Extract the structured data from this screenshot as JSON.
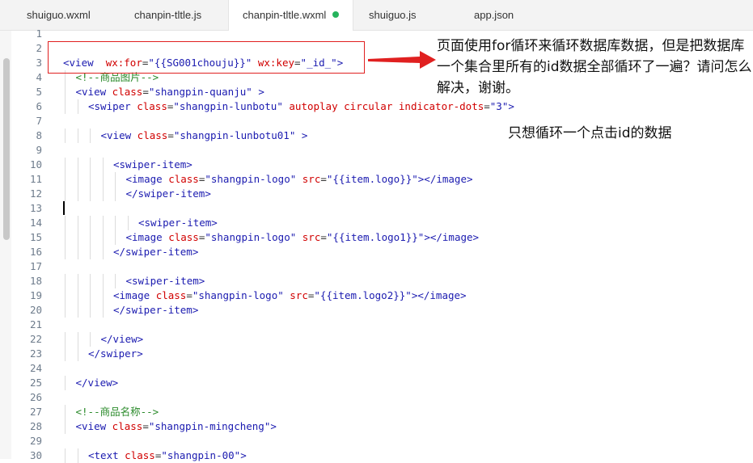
{
  "tabs": [
    {
      "label": "shuiguo.wxml"
    },
    {
      "label": "chanpin-tltle.js"
    },
    {
      "label": "chanpin-tltle.wxml",
      "active": true,
      "modified": true
    },
    {
      "label": "shuiguo.js"
    },
    {
      "label": "app.json"
    }
  ],
  "editor": {
    "lines": [
      {
        "n": "1",
        "indent": 0,
        "tokens": []
      },
      {
        "n": "2",
        "indent": 0,
        "tokens": []
      },
      {
        "n": "3",
        "indent": 0,
        "tokens": [
          {
            "c": "t-tag",
            "t": "<view"
          },
          {
            "c": "t-p",
            "t": "  "
          },
          {
            "c": "t-attr",
            "t": "wx:for"
          },
          {
            "c": "t-p",
            "t": "="
          },
          {
            "c": "t-str",
            "t": "\"{{SG001chouju}}\""
          },
          {
            "c": "t-p",
            "t": " "
          },
          {
            "c": "t-attr",
            "t": "wx:key"
          },
          {
            "c": "t-p",
            "t": "="
          },
          {
            "c": "t-str",
            "t": "\"_id_\""
          },
          {
            "c": "t-tag",
            "t": ">"
          }
        ]
      },
      {
        "n": "4",
        "indent": 1,
        "tokens": [
          {
            "c": "t-cm",
            "t": "<!--商品图片-->"
          }
        ]
      },
      {
        "n": "5",
        "indent": 1,
        "tokens": [
          {
            "c": "t-tag",
            "t": "<view"
          },
          {
            "c": "t-p",
            "t": " "
          },
          {
            "c": "t-attr",
            "t": "class"
          },
          {
            "c": "t-p",
            "t": "="
          },
          {
            "c": "t-str",
            "t": "\"shangpin-quanju\""
          },
          {
            "c": "t-p",
            "t": " "
          },
          {
            "c": "t-tag",
            "t": ">"
          }
        ]
      },
      {
        "n": "6",
        "indent": 2,
        "tokens": [
          {
            "c": "t-tag",
            "t": "<swiper"
          },
          {
            "c": "t-p",
            "t": " "
          },
          {
            "c": "t-attr",
            "t": "class"
          },
          {
            "c": "t-p",
            "t": "="
          },
          {
            "c": "t-str",
            "t": "\"shangpin-lunbotu\""
          },
          {
            "c": "t-p",
            "t": " "
          },
          {
            "c": "t-attr",
            "t": "autoplay"
          },
          {
            "c": "t-p",
            "t": " "
          },
          {
            "c": "t-attr",
            "t": "circular"
          },
          {
            "c": "t-p",
            "t": " "
          },
          {
            "c": "t-attr",
            "t": "indicator-dots"
          },
          {
            "c": "t-p",
            "t": "="
          },
          {
            "c": "t-str",
            "t": "\"3\""
          },
          {
            "c": "t-tag",
            "t": ">"
          }
        ]
      },
      {
        "n": "7",
        "indent": 0,
        "tokens": []
      },
      {
        "n": "8",
        "indent": 3,
        "tokens": [
          {
            "c": "t-tag",
            "t": "<view"
          },
          {
            "c": "t-p",
            "t": " "
          },
          {
            "c": "t-attr",
            "t": "class"
          },
          {
            "c": "t-p",
            "t": "="
          },
          {
            "c": "t-str",
            "t": "\"shangpin-lunbotu01\""
          },
          {
            "c": "t-p",
            "t": " "
          },
          {
            "c": "t-tag",
            "t": ">"
          }
        ]
      },
      {
        "n": "9",
        "indent": 0,
        "tokens": []
      },
      {
        "n": "10",
        "indent": 4,
        "tokens": [
          {
            "c": "t-tag",
            "t": "<swiper-item>"
          }
        ]
      },
      {
        "n": "11",
        "indent": 5,
        "tokens": [
          {
            "c": "t-tag",
            "t": "<image"
          },
          {
            "c": "t-p",
            "t": " "
          },
          {
            "c": "t-attr",
            "t": "class"
          },
          {
            "c": "t-p",
            "t": "="
          },
          {
            "c": "t-str",
            "t": "\"shangpin-logo\""
          },
          {
            "c": "t-p",
            "t": " "
          },
          {
            "c": "t-attr",
            "t": "src"
          },
          {
            "c": "t-p",
            "t": "="
          },
          {
            "c": "t-str",
            "t": "\"{{item.logo}}\""
          },
          {
            "c": "t-tag",
            "t": "></image>"
          }
        ]
      },
      {
        "n": "12",
        "indent": 5,
        "tokens": [
          {
            "c": "t-tag",
            "t": "</swiper-item>"
          }
        ]
      },
      {
        "n": "13",
        "indent": 0,
        "tokens": []
      },
      {
        "n": "14",
        "indent": 6,
        "tokens": [
          {
            "c": "t-tag",
            "t": "<swiper-item>"
          }
        ]
      },
      {
        "n": "15",
        "indent": 5,
        "tokens": [
          {
            "c": "t-tag",
            "t": "<image"
          },
          {
            "c": "t-p",
            "t": " "
          },
          {
            "c": "t-attr",
            "t": "class"
          },
          {
            "c": "t-p",
            "t": "="
          },
          {
            "c": "t-str",
            "t": "\"shangpin-logo\""
          },
          {
            "c": "t-p",
            "t": " "
          },
          {
            "c": "t-attr",
            "t": "src"
          },
          {
            "c": "t-p",
            "t": "="
          },
          {
            "c": "t-str",
            "t": "\"{{item.logo1}}\""
          },
          {
            "c": "t-tag",
            "t": "></image>"
          }
        ]
      },
      {
        "n": "16",
        "indent": 4,
        "tokens": [
          {
            "c": "t-tag",
            "t": "</swiper-item>"
          }
        ]
      },
      {
        "n": "17",
        "indent": 0,
        "tokens": []
      },
      {
        "n": "18",
        "indent": 5,
        "tokens": [
          {
            "c": "t-tag",
            "t": "<swiper-item>"
          }
        ]
      },
      {
        "n": "19",
        "indent": 4,
        "tokens": [
          {
            "c": "t-tag",
            "t": "<image"
          },
          {
            "c": "t-p",
            "t": " "
          },
          {
            "c": "t-attr",
            "t": "class"
          },
          {
            "c": "t-p",
            "t": "="
          },
          {
            "c": "t-str",
            "t": "\"shangpin-logo\""
          },
          {
            "c": "t-p",
            "t": " "
          },
          {
            "c": "t-attr",
            "t": "src"
          },
          {
            "c": "t-p",
            "t": "="
          },
          {
            "c": "t-str",
            "t": "\"{{item.logo2}}\""
          },
          {
            "c": "t-tag",
            "t": "></image>"
          }
        ]
      },
      {
        "n": "20",
        "indent": 4,
        "tokens": [
          {
            "c": "t-tag",
            "t": "</swiper-item>"
          }
        ]
      },
      {
        "n": "21",
        "indent": 0,
        "tokens": []
      },
      {
        "n": "22",
        "indent": 3,
        "tokens": [
          {
            "c": "t-tag",
            "t": "</view>"
          }
        ]
      },
      {
        "n": "23",
        "indent": 2,
        "tokens": [
          {
            "c": "t-tag",
            "t": "</swiper>"
          }
        ]
      },
      {
        "n": "24",
        "indent": 0,
        "tokens": []
      },
      {
        "n": "25",
        "indent": 1,
        "tokens": [
          {
            "c": "t-tag",
            "t": "</view>"
          }
        ]
      },
      {
        "n": "26",
        "indent": 0,
        "tokens": []
      },
      {
        "n": "27",
        "indent": 1,
        "tokens": [
          {
            "c": "t-cm",
            "t": "<!--商品名称-->"
          }
        ]
      },
      {
        "n": "28",
        "indent": 1,
        "tokens": [
          {
            "c": "t-tag",
            "t": "<view"
          },
          {
            "c": "t-p",
            "t": " "
          },
          {
            "c": "t-attr",
            "t": "class"
          },
          {
            "c": "t-p",
            "t": "="
          },
          {
            "c": "t-str",
            "t": "\"shangpin-mingcheng\""
          },
          {
            "c": "t-tag",
            "t": ">"
          }
        ]
      },
      {
        "n": "29",
        "indent": 0,
        "tokens": []
      },
      {
        "n": "30",
        "indent": 2,
        "tokens": [
          {
            "c": "t-tag",
            "t": "<text"
          },
          {
            "c": "t-p",
            "t": " "
          },
          {
            "c": "t-attr",
            "t": "class"
          },
          {
            "c": "t-p",
            "t": "="
          },
          {
            "c": "t-str",
            "t": "\"shangpin-00\""
          },
          {
            "c": "t-tag",
            "t": ">"
          }
        ]
      }
    ]
  },
  "annotation": {
    "note1": "页面使用for循环来循环数据库数据，但是把数据库一个集合里所有的id数据全部循环了一遍？请问怎么解决，谢谢。",
    "note2": "只想循环一个点击id的数据",
    "color": "#e02020"
  },
  "colors": {
    "tag": "#1b1bb0",
    "attr": "#d10000",
    "comment": "#2a8a2a",
    "modified_dot": "#26b35c"
  }
}
